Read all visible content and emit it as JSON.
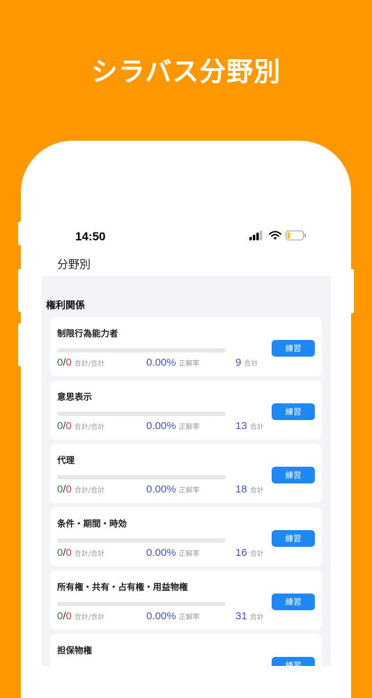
{
  "headline": "シラバス分野別",
  "status_bar": {
    "time": "14:50"
  },
  "nav": {
    "title": "分野別"
  },
  "section": {
    "title": "権利関係"
  },
  "labels": {
    "count_unit": "合計/合計",
    "rate_unit": "正解率",
    "total_unit": "合計",
    "practice_button": "練習"
  },
  "cards": [
    {
      "title": "制限行為能力者",
      "correct": "0",
      "wrong": "0",
      "rate": "0.00%",
      "total": "9",
      "progress": 0
    },
    {
      "title": "意思表示",
      "correct": "0",
      "wrong": "0",
      "rate": "0.00%",
      "total": "13",
      "progress": 0
    },
    {
      "title": "代理",
      "correct": "0",
      "wrong": "0",
      "rate": "0.00%",
      "total": "18",
      "progress": 0
    },
    {
      "title": "条件・期間・時効",
      "correct": "0",
      "wrong": "0",
      "rate": "0.00%",
      "total": "16",
      "progress": 0
    },
    {
      "title": "所有権・共有・占有権・用益物権",
      "correct": "0",
      "wrong": "0",
      "rate": "0.00%",
      "total": "31",
      "progress": 0
    },
    {
      "title": "担保物権",
      "correct": "",
      "wrong": "",
      "rate": "",
      "total": "",
      "progress": 0
    }
  ],
  "colors": {
    "background": "#FF9800",
    "button": "#1E88F5",
    "correct": "#2E7D32",
    "wrong": "#E53935",
    "stat": "#3F51E0"
  }
}
